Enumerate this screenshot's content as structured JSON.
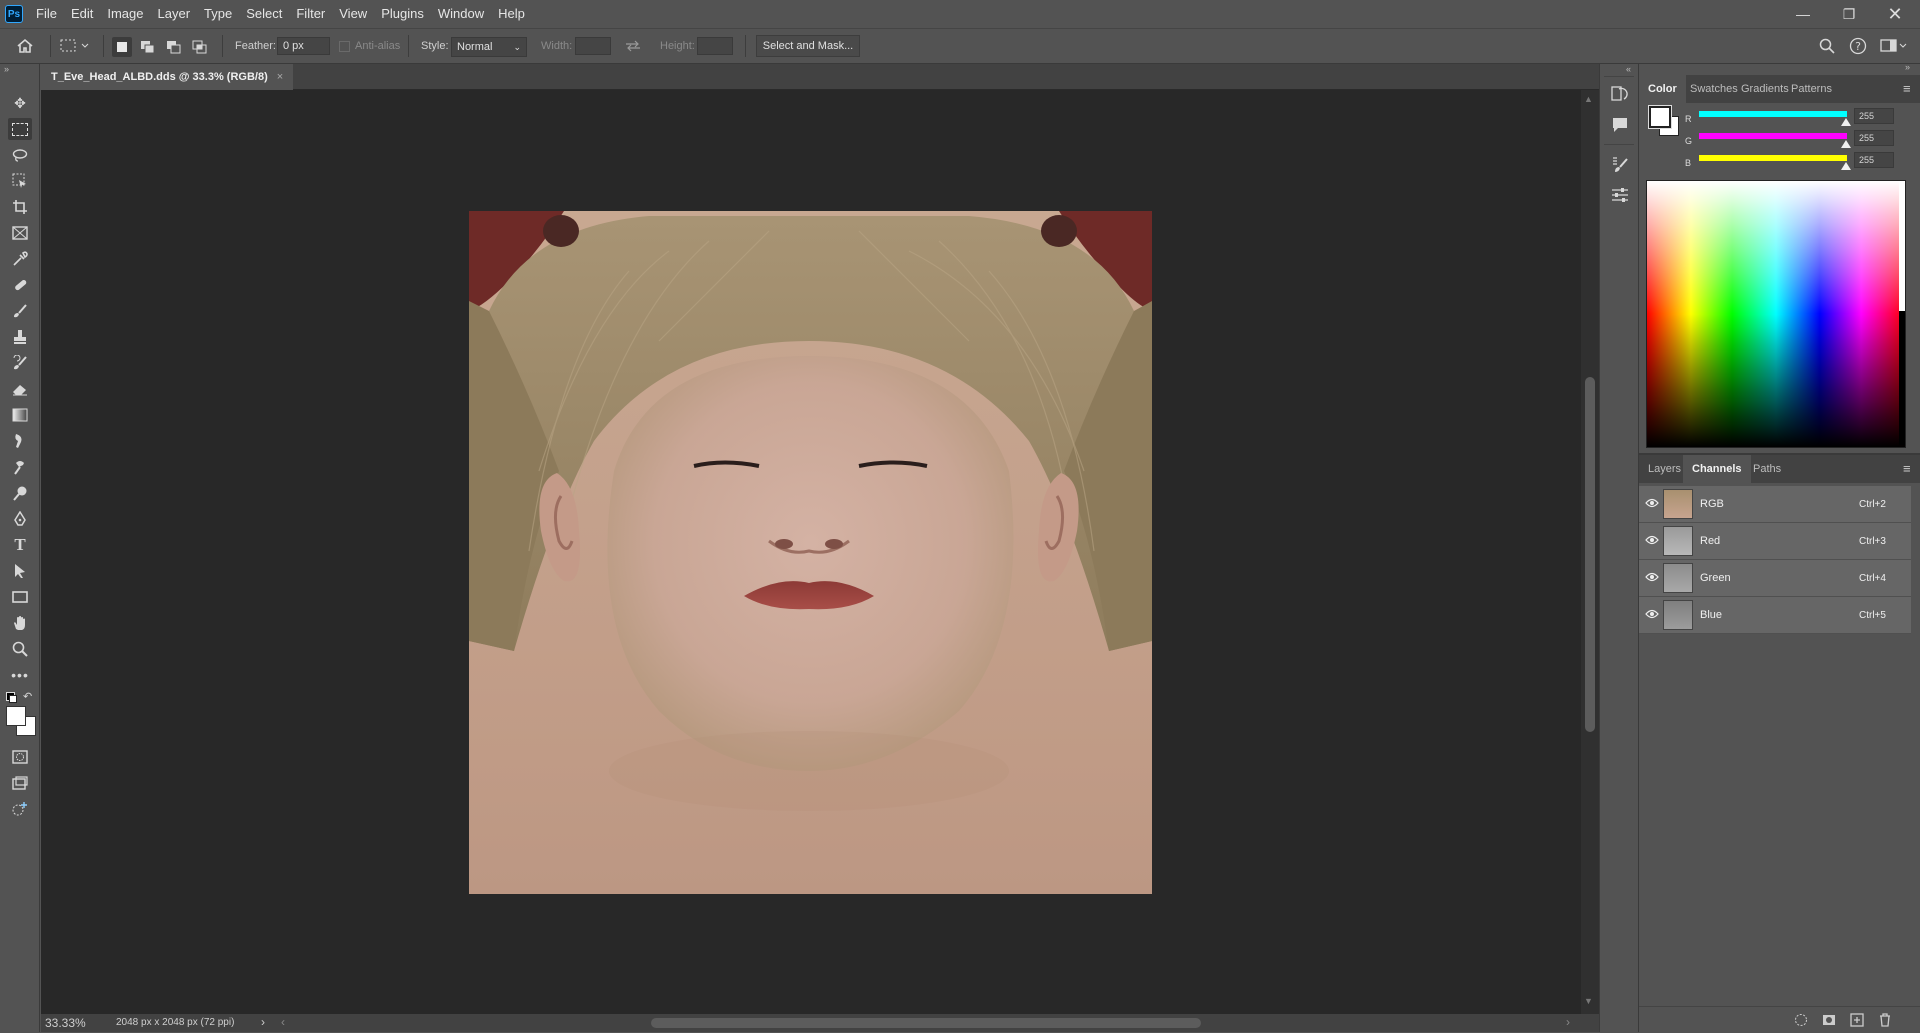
{
  "app": {
    "logo": "Ps"
  },
  "menu": [
    "File",
    "Edit",
    "Image",
    "Layer",
    "Type",
    "Select",
    "Filter",
    "View",
    "Plugins",
    "Window",
    "Help"
  ],
  "options": {
    "feather_label": "Feather:",
    "feather_value": "0 px",
    "antialias_label": "Anti-alias",
    "style_label": "Style:",
    "style_value": "Normal",
    "width_label": "Width:",
    "height_label": "Height:",
    "select_mask_label": "Select and Mask..."
  },
  "document": {
    "tab_title": "T_Eve_Head_ALBD.dds @ 33.3% (RGB/8)",
    "zoom": "33.33%",
    "doc_info": "2048 px x 2048 px (72 ppi)"
  },
  "color_panel": {
    "tabs": [
      "Color",
      "Swatches",
      "Gradients",
      "Patterns"
    ],
    "sliders": [
      {
        "label": "R",
        "value": "255",
        "color": "#00ffff"
      },
      {
        "label": "G",
        "value": "255",
        "color": "#ff00ff"
      },
      {
        "label": "B",
        "value": "255",
        "color": "#ffff00"
      }
    ]
  },
  "channels_panel": {
    "tabs": [
      "Layers",
      "Channels",
      "Paths"
    ],
    "rows": [
      {
        "name": "RGB",
        "shortcut": "Ctrl+2"
      },
      {
        "name": "Red",
        "shortcut": "Ctrl+3"
      },
      {
        "name": "Green",
        "shortcut": "Ctrl+4"
      },
      {
        "name": "Blue",
        "shortcut": "Ctrl+5"
      }
    ]
  },
  "colors": {
    "accent": "#31a8ff",
    "canvas_bg": "#282828",
    "panel_bg": "#535353"
  }
}
